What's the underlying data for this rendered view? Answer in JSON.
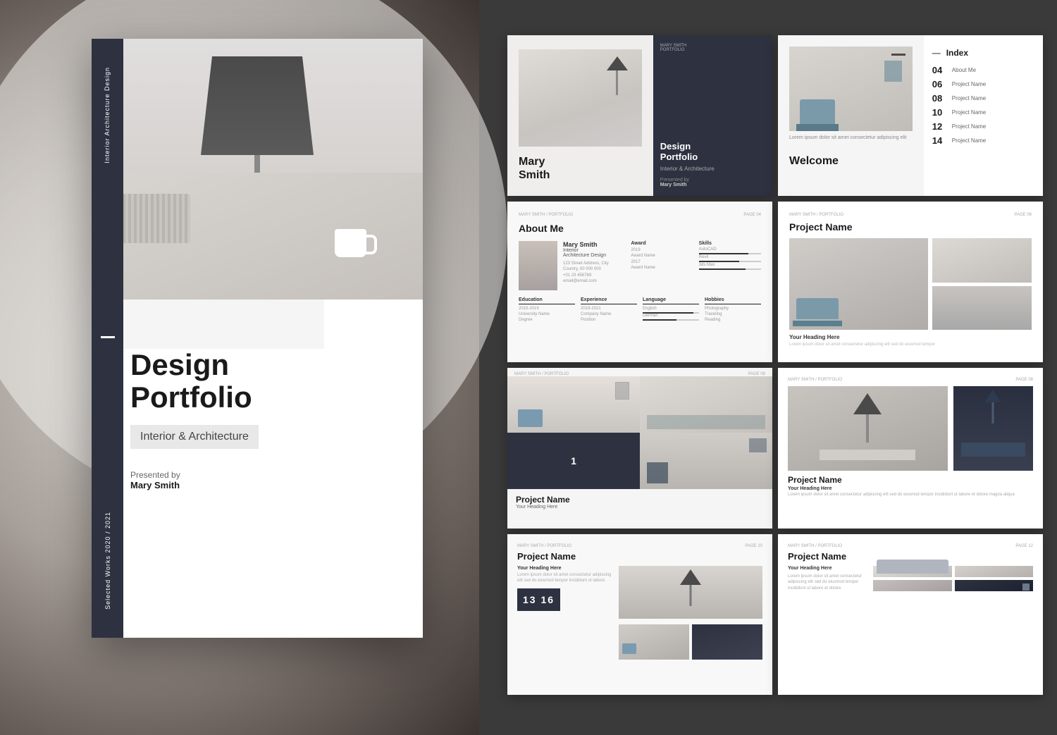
{
  "cover": {
    "sidebar_top": "Interior Architecture Design",
    "sidebar_bottom": "Selected Works 2020 / 2021",
    "title_line1": "Design",
    "title_line2": "Portfolio",
    "subtitle": "Interior & Architecture",
    "presented_by": "Presented by",
    "author": "Mary Smith"
  },
  "thumbnails": {
    "thumb1": {
      "name_line1": "Mary",
      "name_line2": "Smith",
      "right_title_line1": "Design",
      "right_title_line2": "Portfolio",
      "right_subtitle": "Interior & Architecture",
      "right_presented": "Presented by",
      "right_author": "Mary Smith"
    },
    "thumb2": {
      "index_title": "— Index",
      "items": [
        {
          "num": "04",
          "label": "About Me"
        },
        {
          "num": "06",
          "label": "Project Name"
        },
        {
          "num": "08",
          "label": "Project Name"
        },
        {
          "num": "10",
          "label": "Project Name"
        },
        {
          "num": "12",
          "label": "Project Name"
        },
        {
          "num": "14",
          "label": "Project Name"
        }
      ],
      "welcome_title": "Welcome"
    },
    "thumb3": {
      "title": "About Me"
    },
    "thumb4": {
      "title": "Project Name",
      "heading": "Your Heading Here"
    },
    "thumb5": {
      "title": "Project Name",
      "heading": "Your Heading Here"
    },
    "thumb6": {
      "title": "Project Name",
      "heading": "Your Heading Here"
    },
    "thumb7": {
      "title": "Project Name",
      "heading": "Your Heading Here"
    },
    "thumb8": {
      "title": "Project Name",
      "heading": "Your Heading Here"
    }
  },
  "colors": {
    "dark_navy": "#2d3140",
    "light_gray": "#f5f5f5",
    "mid_gray": "#e8e8e8",
    "text_dark": "#1a1a1a",
    "text_light": "#ffffff"
  }
}
